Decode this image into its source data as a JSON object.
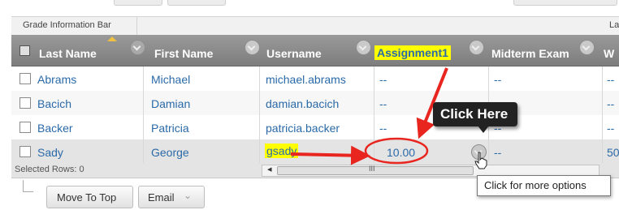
{
  "info_bar": {
    "title": "Grade Information Bar",
    "right_fragment": "La"
  },
  "columns": [
    {
      "label": "Last Name"
    },
    {
      "label": "First Name"
    },
    {
      "label": "Username"
    },
    {
      "label": "Assignment1"
    },
    {
      "label": "Midterm Exam"
    },
    {
      "label": "W"
    }
  ],
  "rows": [
    {
      "last": "Abrams",
      "first": "Michael",
      "username": "michael.abrams",
      "assignment1": "--",
      "midterm": "--",
      "w": "--"
    },
    {
      "last": "Bacich",
      "first": "Damian",
      "username": "damian.bacich",
      "assignment1": "--",
      "midterm": "--",
      "w": "--"
    },
    {
      "last": "Backer",
      "first": "Patricia",
      "username": "patricia.backer",
      "assignment1": "--",
      "midterm": "--",
      "w": "--"
    },
    {
      "last": "Sady",
      "first": "George",
      "username": "gsady",
      "assignment1": "10.00",
      "midterm": "--",
      "w": "50"
    }
  ],
  "footer": {
    "selected_rows_label": "Selected Rows: 0"
  },
  "actions": {
    "move_to_top": "Move To Top",
    "email": "Email"
  },
  "callout": {
    "text": "Click Here"
  },
  "tooltip": {
    "text": "Click for more options"
  },
  "colors": {
    "header_bg": "#8c8c8c",
    "link": "#2a6aa8",
    "highlight": "#ffff00",
    "annotation_red": "#e8251e",
    "callout_bg": "#222222"
  }
}
